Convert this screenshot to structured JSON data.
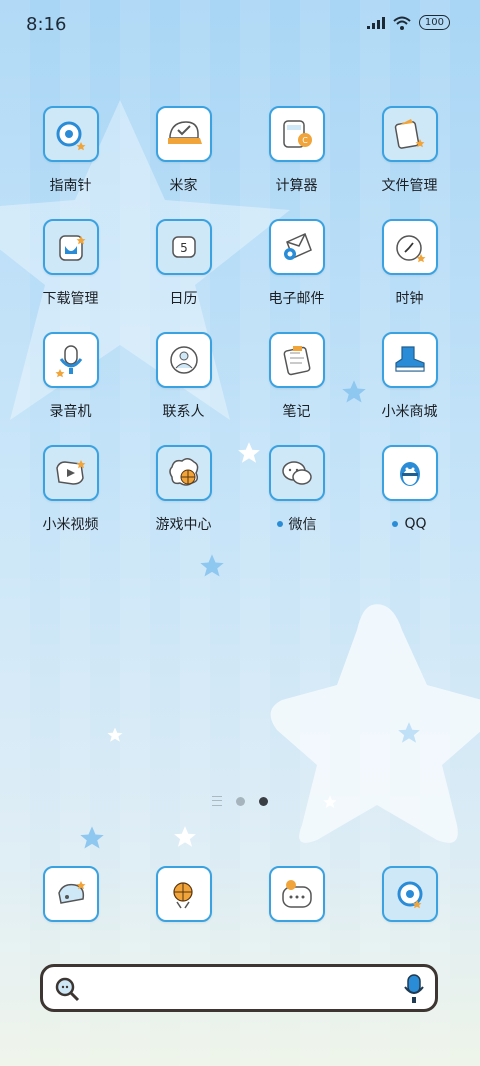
{
  "status_bar": {
    "time": "8:16",
    "battery": "100",
    "icons": [
      "signal-icon",
      "wifi-icon",
      "battery-icon"
    ]
  },
  "apps": [
    {
      "label": "指南针",
      "icon": "compass-icon",
      "filled": true
    },
    {
      "label": "米家",
      "icon": "mi-home-icon",
      "filled": false
    },
    {
      "label": "计算器",
      "icon": "calculator-icon",
      "filled": false
    },
    {
      "label": "文件管理",
      "icon": "file-manager-icon",
      "filled": true
    },
    {
      "label": "下载管理",
      "icon": "download-manager-icon",
      "filled": true
    },
    {
      "label": "日历",
      "icon": "calendar-icon",
      "filled": true,
      "glyph": "5"
    },
    {
      "label": "电子邮件",
      "icon": "email-icon",
      "filled": false
    },
    {
      "label": "时钟",
      "icon": "clock-icon",
      "filled": false
    },
    {
      "label": "录音机",
      "icon": "recorder-icon",
      "filled": false
    },
    {
      "label": "联系人",
      "icon": "contacts-icon",
      "filled": false
    },
    {
      "label": "笔记",
      "icon": "notes-icon",
      "filled": false
    },
    {
      "label": "小米商城",
      "icon": "mi-store-icon",
      "filled": false
    },
    {
      "label": "小米视频",
      "icon": "mi-video-icon",
      "filled": true
    },
    {
      "label": "游戏中心",
      "icon": "game-center-icon",
      "filled": true
    },
    {
      "label": "微信",
      "icon": "wechat-icon",
      "filled": true,
      "badge_dot": true
    },
    {
      "label": "QQ",
      "icon": "qq-icon",
      "filled": false,
      "badge_dot": true
    }
  ],
  "page_indicator": {
    "pages": 2,
    "active": 2
  },
  "dock": [
    {
      "icon": "phone-icon"
    },
    {
      "icon": "basketball-icon"
    },
    {
      "icon": "messages-icon"
    },
    {
      "icon": "browser-icon"
    }
  ],
  "search_bar": {
    "left_icon": "search-icon",
    "right_icon": "microphone-icon"
  },
  "colors": {
    "accent": "#3aa2e0",
    "badge": "#2a8cd6",
    "orange": "#f0a43a",
    "text": "#1b1f24",
    "bg_top": "#a9d6f5",
    "bg_bottom": "#eef4e9"
  }
}
